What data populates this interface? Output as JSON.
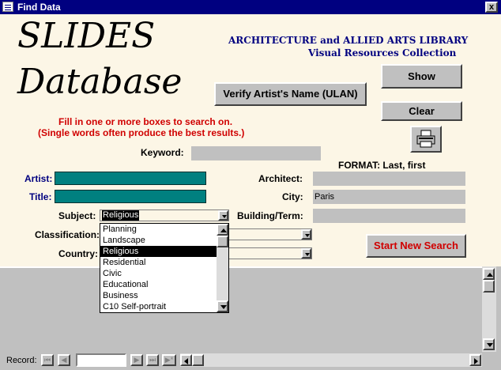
{
  "window": {
    "title": "Find Data",
    "close_glyph": "x"
  },
  "header": {
    "title_line1": "SLIDES",
    "title_line2": "Database",
    "library_line1": "ARCHITECTURE and ALLIED ARTS LIBRARY",
    "library_line2": "Visual Resources Collection"
  },
  "buttons": {
    "show": "Show",
    "clear": "Clear",
    "verify": "Verify Artist's Name (ULAN)",
    "start_new": "Start New Search"
  },
  "instructions": {
    "line1": "Fill in one or more boxes to search on.",
    "line2": "(Single words often produce the best results.)"
  },
  "fields": {
    "keyword_label": "Keyword:",
    "keyword_value": "",
    "format_note": "FORMAT: Last, first",
    "artist_label": "Artist:",
    "artist_value": "",
    "title_label": "Title:",
    "title_value": "",
    "architect_label": "Architect:",
    "architect_value": "",
    "city_label": "City:",
    "city_value": "Paris",
    "subject_label": "Subject:",
    "subject_value": "Religious",
    "building_label": "Building/Term:",
    "building_value": "",
    "classification_label": "Classification:",
    "classification_value": "",
    "country_label": "Country:",
    "country_value": ""
  },
  "subject_dropdown": {
    "options": [
      "Planning",
      "Landscape",
      "Religious",
      "Residential",
      "Civic",
      "Educational",
      "Business",
      "C10 Self-portrait"
    ],
    "selected": "Religious"
  },
  "record_nav": {
    "label": "Record:",
    "value": ""
  },
  "icons": {
    "printer": "printer-icon",
    "first": "⏮",
    "prev": "◀",
    "next": "▶",
    "last": "⏭",
    "new": "▶*"
  }
}
